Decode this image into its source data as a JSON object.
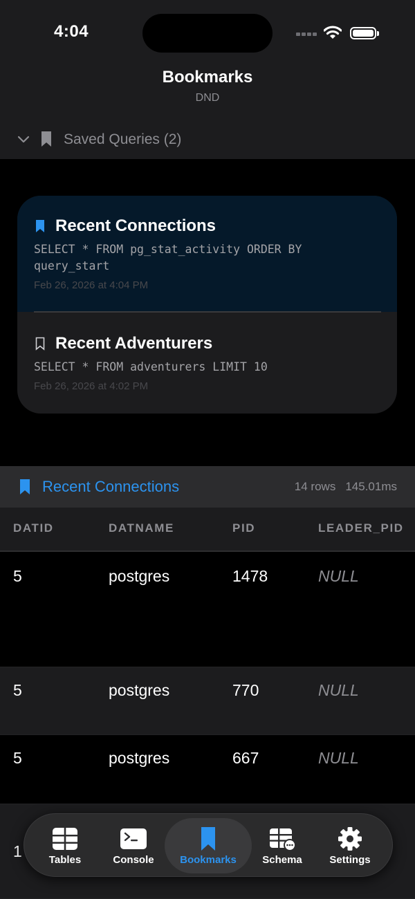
{
  "status_bar": {
    "time": "4:04"
  },
  "nav": {
    "title": "Bookmarks",
    "subtitle": "DND"
  },
  "saved_queries": {
    "section_title": "Saved Queries (2)",
    "items": [
      {
        "title": "Recent Connections",
        "sql": "SELECT * FROM pg_stat_activity ORDER BY query_start",
        "date": "Feb 26, 2026 at 4:04 PM",
        "selected": true
      },
      {
        "title": "Recent Adventurers",
        "sql": "SELECT * FROM adventurers LIMIT 10",
        "date": "Feb 26, 2026 at 4:02 PM",
        "selected": false
      }
    ]
  },
  "results": {
    "title": "Recent Connections",
    "row_count": "14 rows",
    "duration": "145.01ms",
    "columns": [
      "DATID",
      "DATNAME",
      "PID",
      "LEADER_PID"
    ],
    "rows": [
      [
        "5",
        "postgres",
        "1478",
        "NULL"
      ],
      [
        "5",
        "postgres",
        "770",
        "NULL"
      ],
      [
        "5",
        "postgres",
        "667",
        "NULL"
      ],
      [
        "1"
      ]
    ]
  },
  "tab_bar": {
    "tabs": [
      {
        "label": "Tables",
        "icon": "table-icon"
      },
      {
        "label": "Console",
        "icon": "terminal-icon"
      },
      {
        "label": "Bookmarks",
        "icon": "bookmark-icon",
        "active": true
      },
      {
        "label": "Schema",
        "icon": "schema-icon"
      },
      {
        "label": "Settings",
        "icon": "gear-icon"
      }
    ]
  },
  "colors": {
    "accent": "#2c93ef",
    "background": "#000000",
    "surface": "#1c1c1e",
    "selected_card": "#05192a"
  }
}
